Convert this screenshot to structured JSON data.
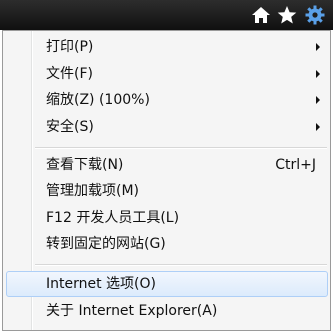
{
  "toolbar": {
    "icons": [
      "home-icon",
      "star-icon",
      "gear-icon"
    ]
  },
  "menu": {
    "print": "打印(P)",
    "file": "文件(F)",
    "zoom": "缩放(Z) (100%)",
    "safety": "安全(S)",
    "downloads": "查看下载(N)",
    "downloads_shortcut": "Ctrl+J",
    "addons": "管理加载项(M)",
    "devtools": "F12 开发人员工具(L)",
    "pinned": "转到固定的网站(G)",
    "options": "Internet 选项(O)",
    "about": "关于 Internet Explorer(A)"
  },
  "colors": {
    "toolbar": "#1e1e1e",
    "gear": "#5aa0e8",
    "highlight": "#dcebfc"
  }
}
